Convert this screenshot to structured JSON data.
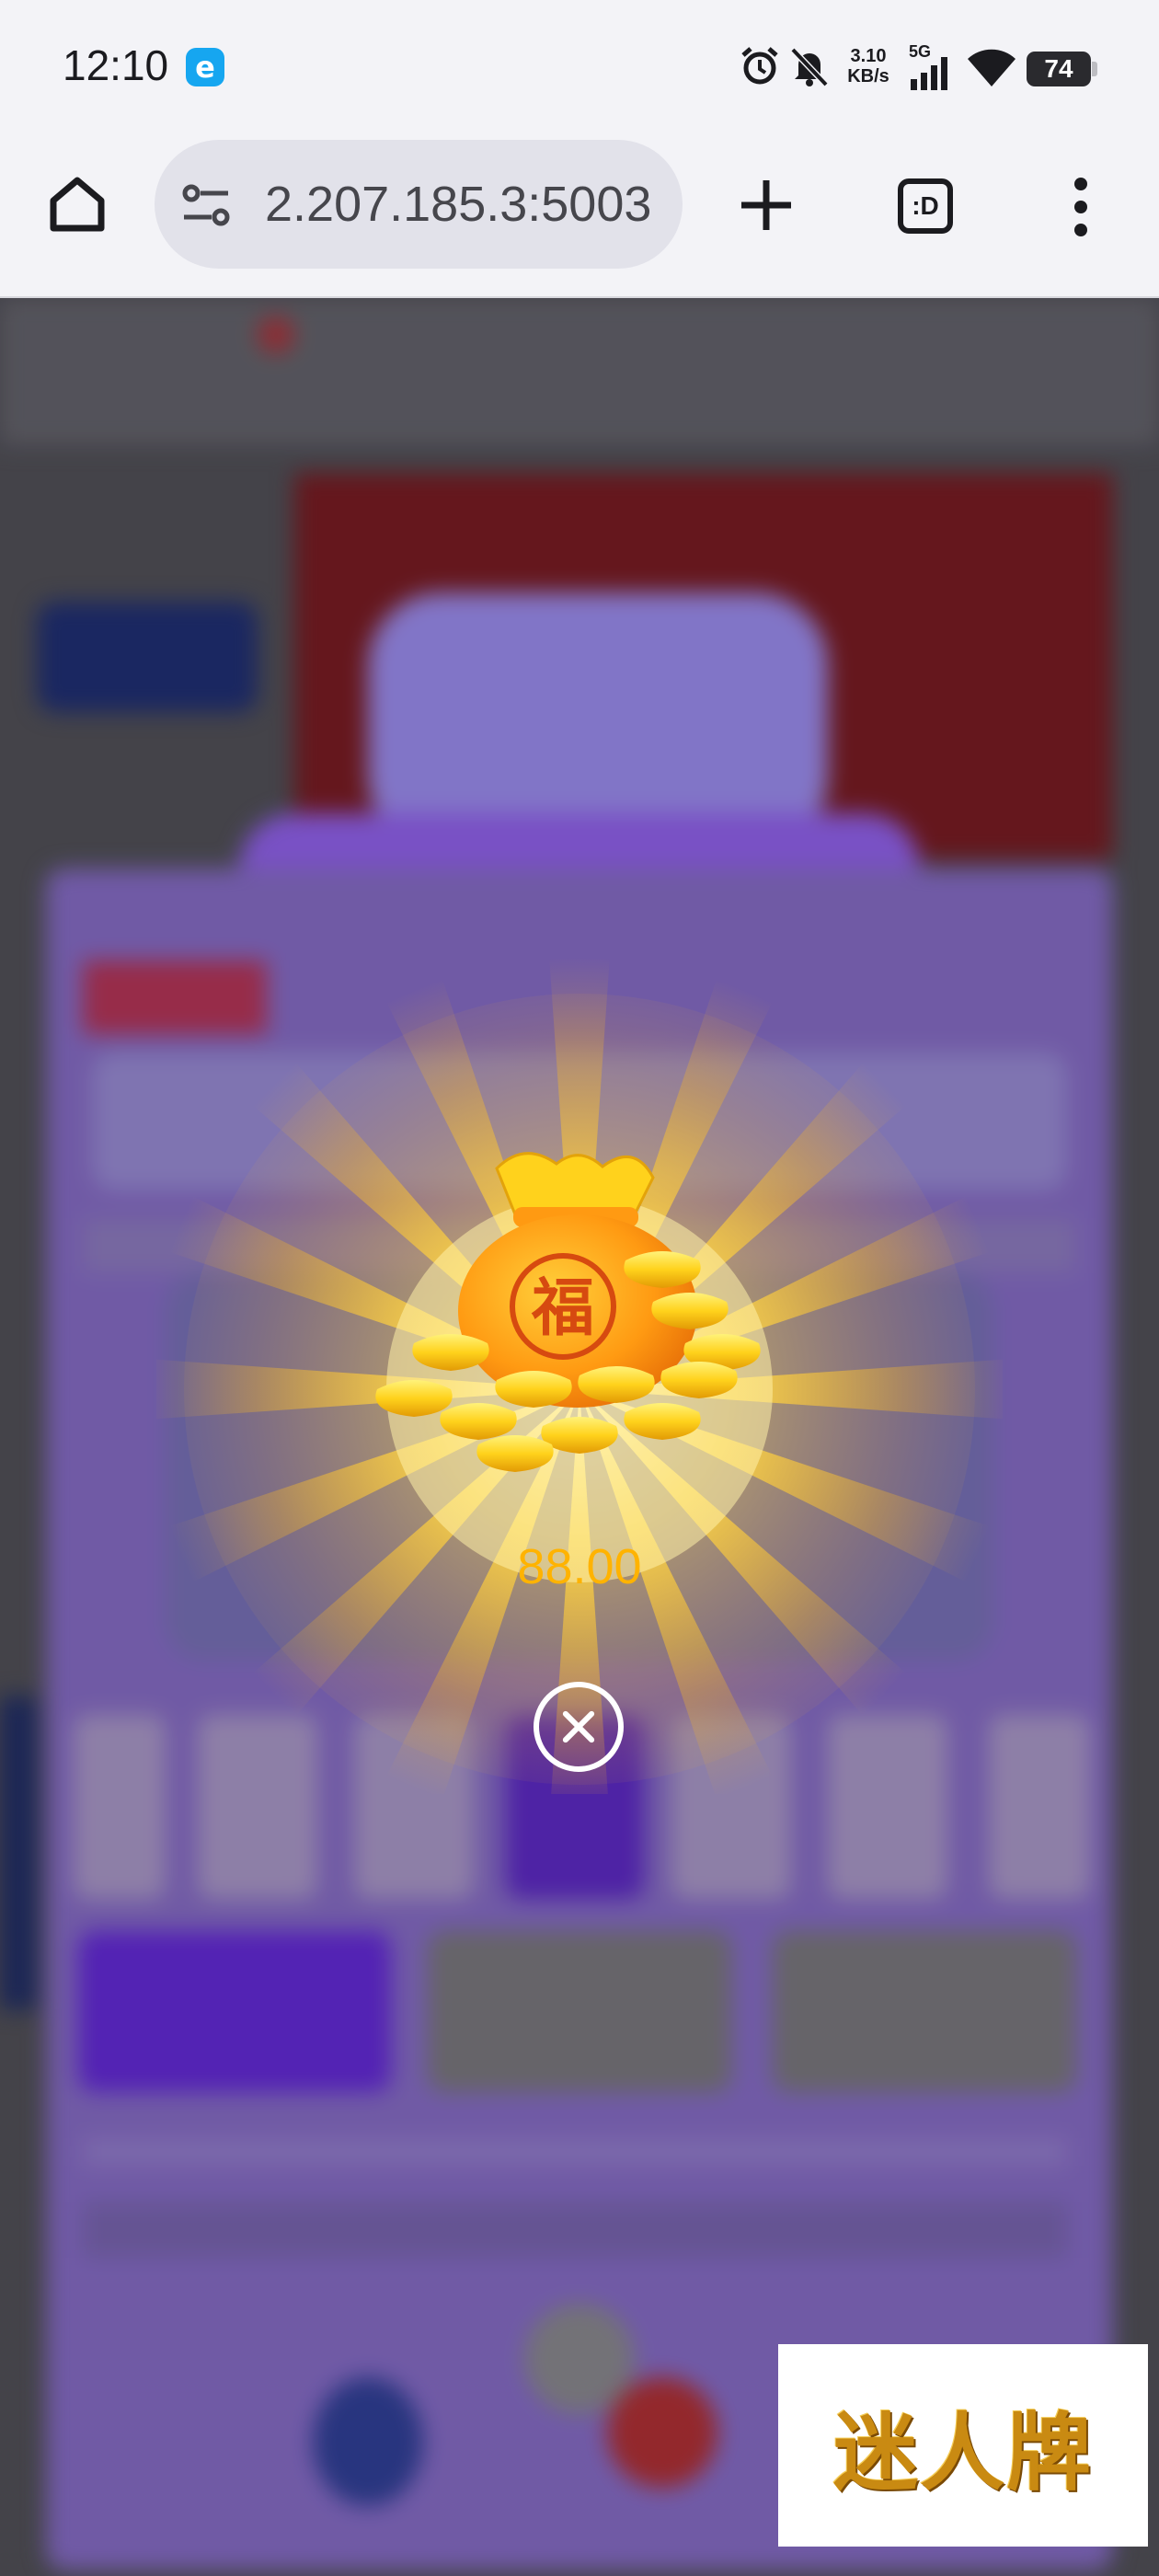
{
  "status_bar": {
    "time": "12:10",
    "app_badge": "e",
    "net_speed": "3.10\nKB/s",
    "signal_label": "5G",
    "battery": "74"
  },
  "browser": {
    "url": "2.207.185.3:5003",
    "tab_count": ":D"
  },
  "popup": {
    "bag_character": "福",
    "reward_amount": "88.00"
  },
  "watermark": {
    "text": "迷人牌"
  },
  "colors": {
    "accent_purple": "#6a2fc8",
    "reward_gold": "#ffb300"
  }
}
